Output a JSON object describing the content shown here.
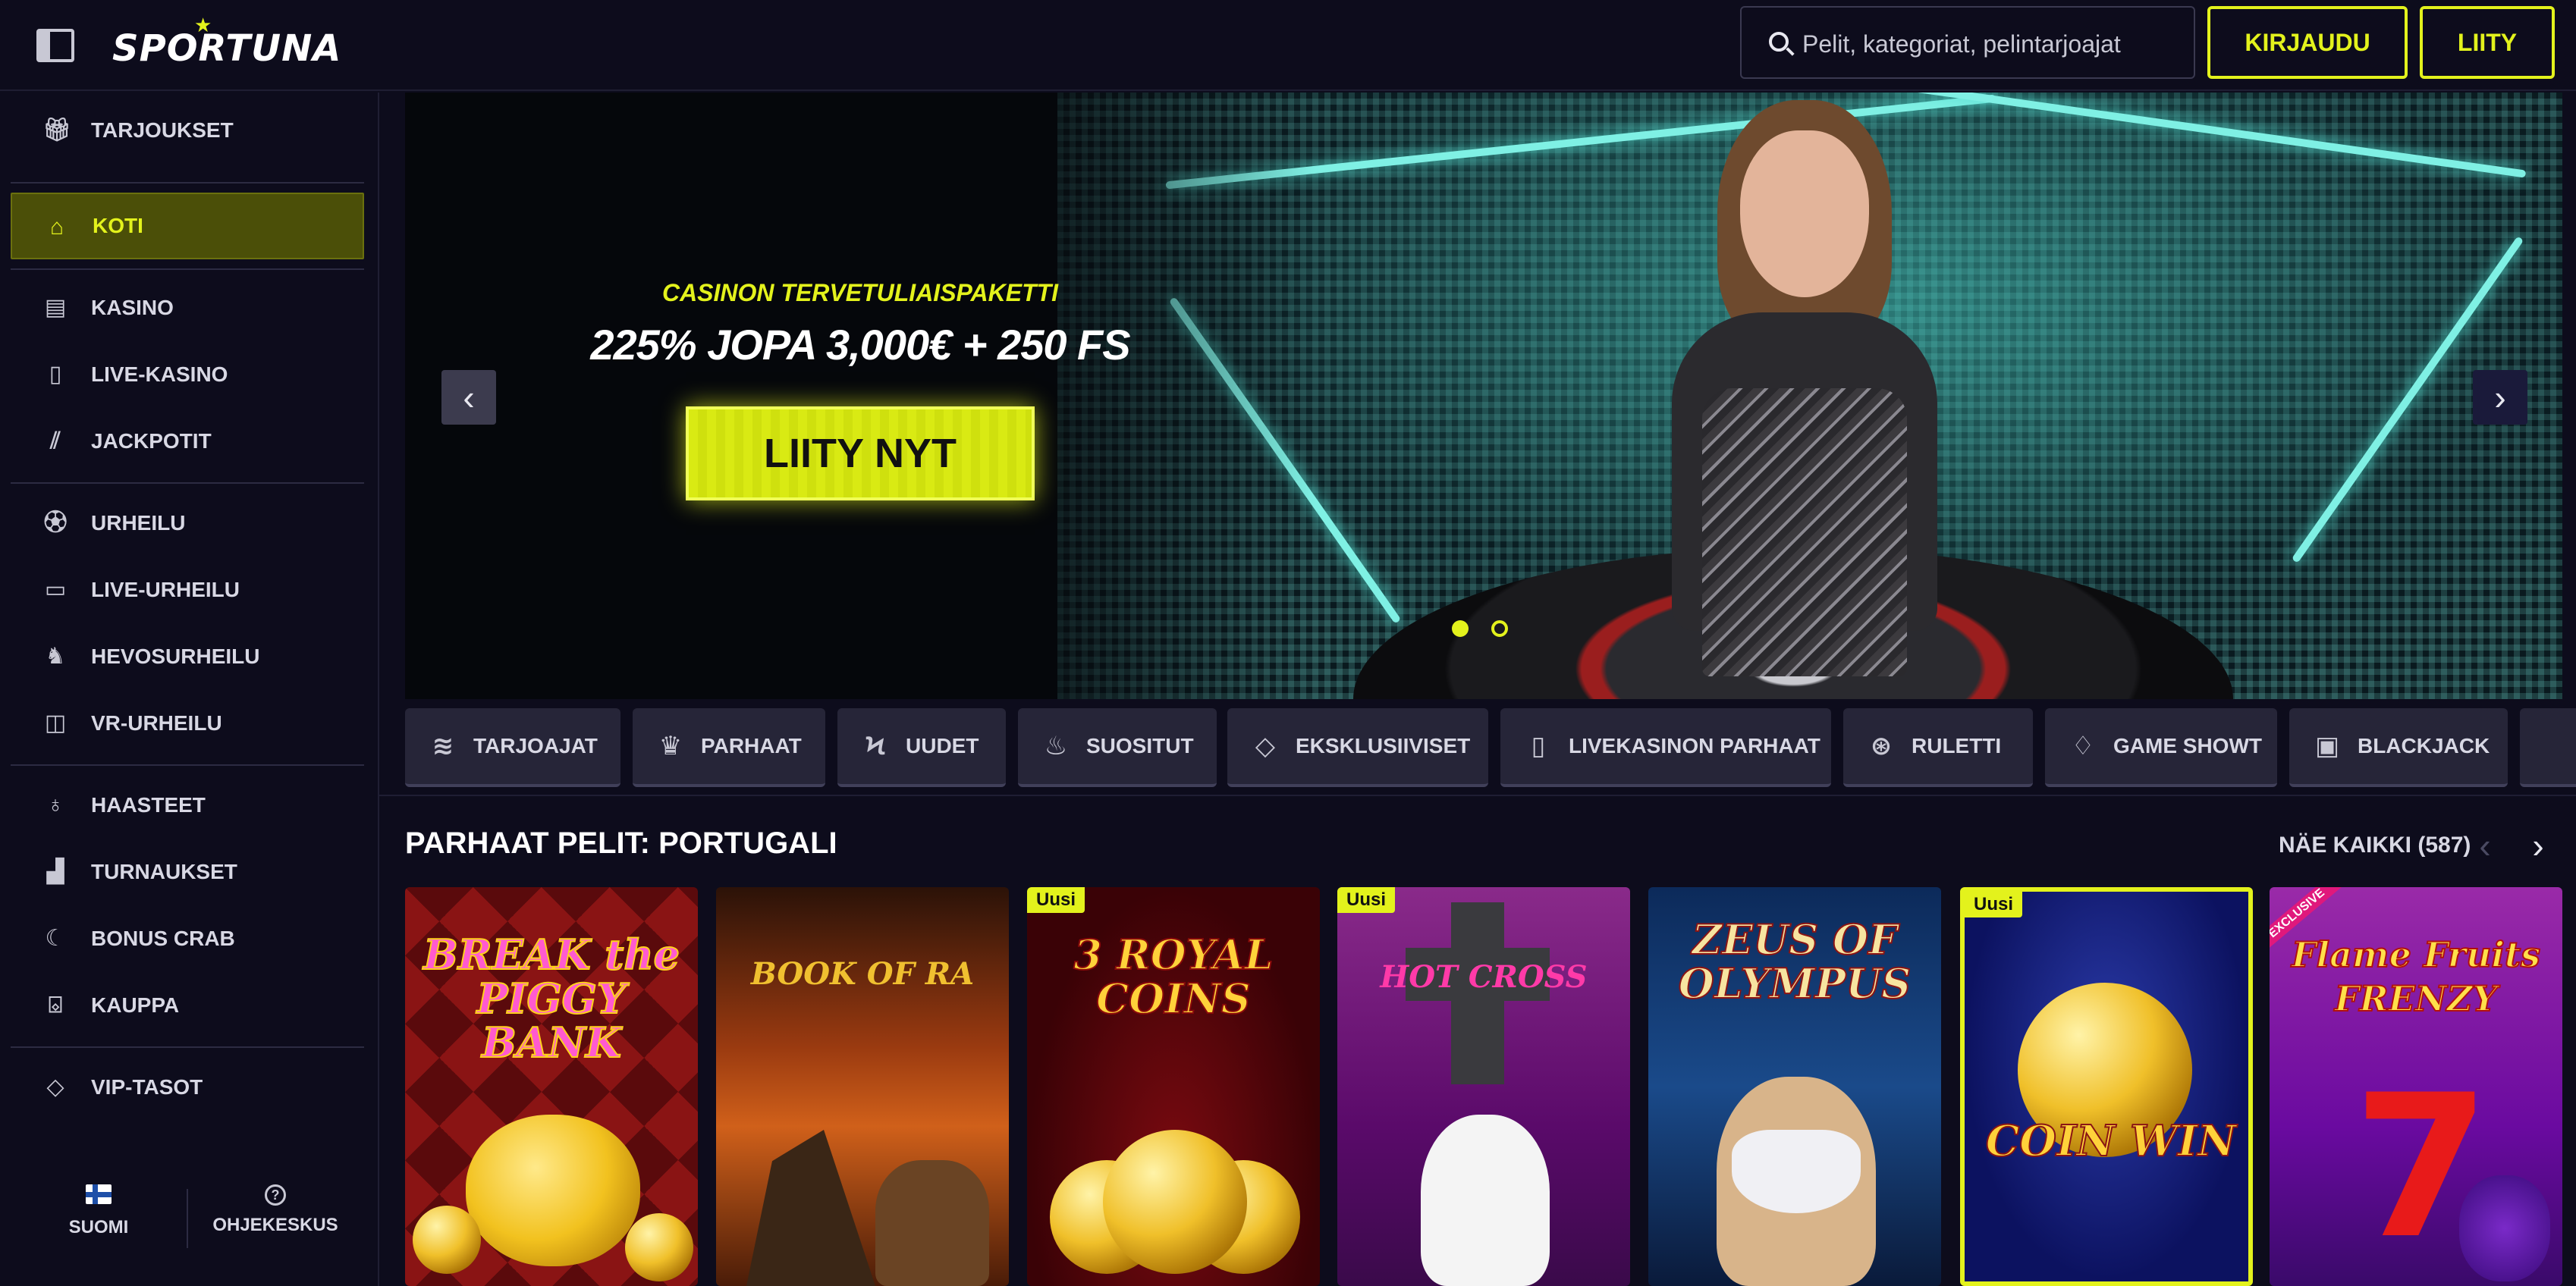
{
  "header": {
    "logo_text": "SPORTUNA",
    "search_placeholder": "Pelit, kategoriat, pelintarjoajat",
    "login_label": "KIRJAUDU",
    "join_label": "LIITY"
  },
  "sidebar": {
    "items": [
      {
        "label": "TARJOUKSET",
        "icon": "gift-icon"
      },
      {
        "label": "KOTI",
        "icon": "home-icon",
        "active": true
      },
      {
        "label": "KASINO",
        "icon": "slot-machine-icon"
      },
      {
        "label": "LIVE-KASINO",
        "icon": "card-icon"
      },
      {
        "label": "JACKPOTIT",
        "icon": "jackpot-icon"
      },
      {
        "label": "URHEILU",
        "icon": "soccer-ball-icon"
      },
      {
        "label": "LIVE-URHEILU",
        "icon": "video-camera-icon"
      },
      {
        "label": "HEVOSURHEILU",
        "icon": "horse-icon"
      },
      {
        "label": "VR-URHEILU",
        "icon": "gamepad-icon"
      },
      {
        "label": "HAASTEET",
        "icon": "badge-icon"
      },
      {
        "label": "TURNAUKSET",
        "icon": "podium-icon"
      },
      {
        "label": "BONUS CRAB",
        "icon": "crab-claw-icon"
      },
      {
        "label": "KAUPPA",
        "icon": "basket-icon"
      },
      {
        "label": "VIP-TASOT",
        "icon": "diamond-icon"
      }
    ],
    "language_label": "SUOMI",
    "help_label": "OHJEKESKUS"
  },
  "banner": {
    "kicker": "CASINON TERVETULIAISPAKETTI",
    "headline": "225% JOPA 3,000€ + 250 FS",
    "cta_label": "LIITY NYT",
    "slide_count": 2,
    "active_slide": 1
  },
  "categories": [
    {
      "label": "TARJOAJAT",
      "icon": "layers-icon"
    },
    {
      "label": "PARHAAT",
      "icon": "crown-icon"
    },
    {
      "label": "UUDET",
      "icon": "lightning-icon"
    },
    {
      "label": "SUOSITUT",
      "icon": "flame-icon"
    },
    {
      "label": "EKSKLUSIIVISET",
      "icon": "diamond-icon"
    },
    {
      "label": "LIVEKASINON PARHAAT",
      "icon": "card-icon"
    },
    {
      "label": "RULETTI",
      "icon": "roulette-icon"
    },
    {
      "label": "GAME SHOWT",
      "icon": "microphone-icon"
    },
    {
      "label": "BLACKJACK",
      "icon": "blackjack-icon"
    }
  ],
  "top_games": {
    "title": "PARHAAT PELIT: PORTUGALI",
    "see_all_label": "NÄE KAIKKI (587)",
    "new_badge": "Uusi",
    "exclusive_badge": "EXCLUSIVE",
    "games": [
      {
        "title": "BREAK the PIGGY BANK",
        "badge": ""
      },
      {
        "title": "BOOK OF RA",
        "badge": ""
      },
      {
        "title": "3 ROYAL COINS",
        "badge": "Uusi"
      },
      {
        "title": "HOT CROSS",
        "badge": "Uusi"
      },
      {
        "title": "ZEUS OF OLYMPUS",
        "badge": ""
      },
      {
        "title": "COIN WIN",
        "badge": "Uusi"
      },
      {
        "title": "Flame Fruits FRENZY",
        "badge": "EXCLUSIVE"
      }
    ]
  },
  "colors": {
    "accent": "#e3f21c",
    "background": "#0d0c1c",
    "chip": "#262538"
  }
}
